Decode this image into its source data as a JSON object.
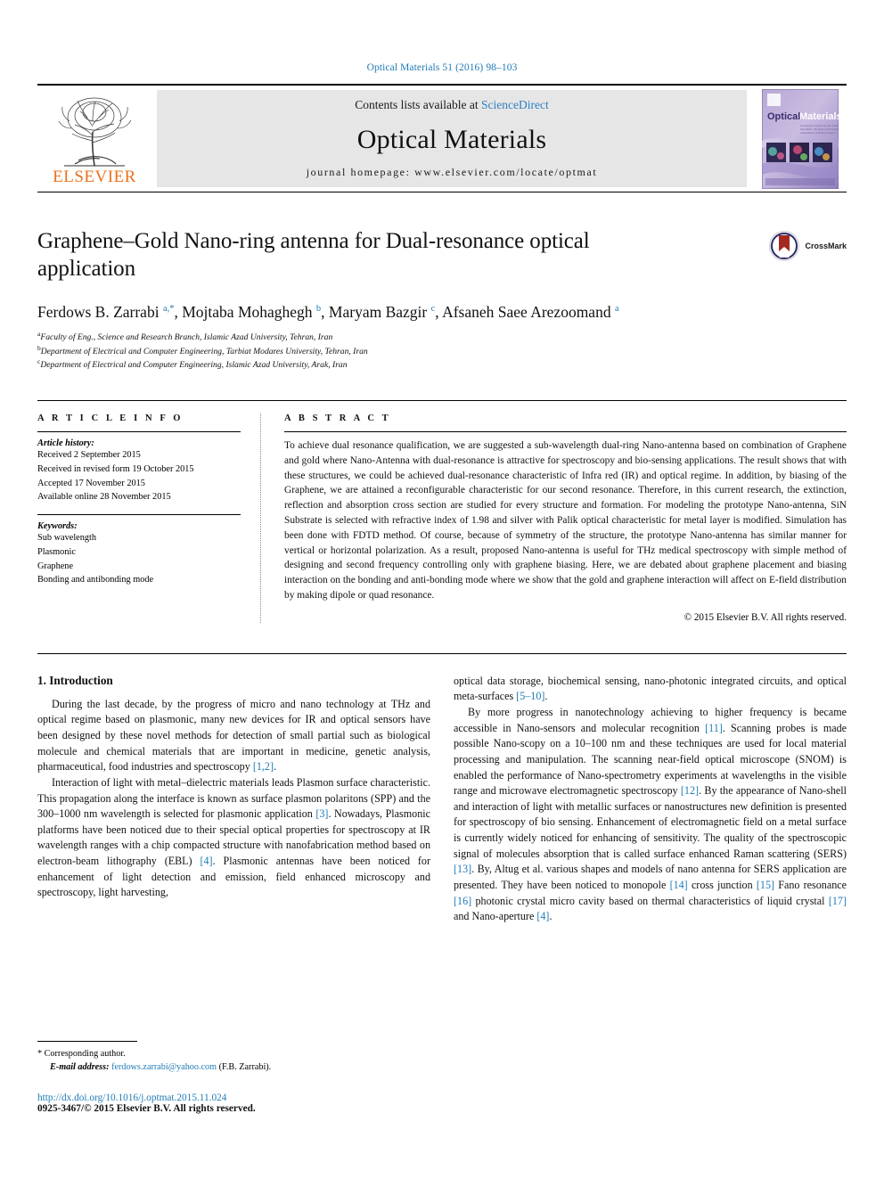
{
  "running_head": "Optical Materials 51 (2016) 98–103",
  "masthead": {
    "publisher": "ELSEVIER",
    "contents_prefix": "Contents lists available at ",
    "contents_link": "ScienceDirect",
    "journal_title": "Optical Materials",
    "homepage": "journal homepage: www.elsevier.com/locate/optmat",
    "cover_title_1": "Optical",
    "cover_title_2": "Materials"
  },
  "article": {
    "title": "Graphene–Gold Nano-ring antenna for Dual-resonance optical application",
    "crossmark_label": "CrossMark",
    "authors_html": "Ferdows B. Zarrabi <sup>a,*</sup>, Mojtaba Mohaghegh <sup>b</sup>, Maryam Bazgir <sup>c</sup>, Afsaneh Saee Arezoomand <sup>a</sup>",
    "affiliations": [
      {
        "marker": "a",
        "text": "Faculty of Eng., Science and Research Branch, Islamic Azad University, Tehran, Iran"
      },
      {
        "marker": "b",
        "text": "Department of Electrical and Computer Engineering, Tarbiat Modares University, Tehran, Iran"
      },
      {
        "marker": "c",
        "text": "Department of Electrical and Computer Engineering, Islamic Azad University, Arak, Iran"
      }
    ]
  },
  "article_info": {
    "heading": "A R T I C L E   I N F O",
    "history_label": "Article history:",
    "history": [
      "Received 2 September 2015",
      "Received in revised form 19 October 2015",
      "Accepted 17 November 2015",
      "Available online 28 November 2015"
    ],
    "keywords_label": "Keywords:",
    "keywords": [
      "Sub wavelength",
      "Plasmonic",
      "Graphene",
      "Bonding and antibonding mode"
    ]
  },
  "abstract": {
    "heading": "A B S T R A C T",
    "text": "To achieve dual resonance qualification, we are suggested a sub-wavelength dual-ring Nano-antenna based on combination of Graphene and gold where Nano-Antenna with dual-resonance is attractive for spectroscopy and bio-sensing applications. The result shows that with these structures, we could be achieved dual-resonance characteristic of Infra red (IR) and optical regime. In addition, by biasing of the Graphene, we are attained a reconfigurable characteristic for our second resonance. Therefore, in this current research, the extinction, reflection and absorption cross section are studied for every structure and formation. For modeling the prototype Nano-antenna, SiN Substrate is selected with refractive index of 1.98 and silver with Palik optical characteristic for metal layer is modified. Simulation has been done with FDTD method. Of course, because of symmetry of the structure, the prototype Nano-antenna has similar manner for vertical or horizontal polarization. As a result, proposed Nano-antenna is useful for THz medical spectroscopy with simple method of designing and second frequency controlling only with graphene biasing. Here, we are debated about graphene placement and biasing interaction on the bonding and anti-bonding mode where we show that the gold and graphene interaction will affect on E-field distribution by making dipole or quad resonance.",
    "copyright": "© 2015 Elsevier B.V. All rights reserved."
  },
  "body": {
    "section_heading": "1. Introduction",
    "left_paragraphs_html": [
      "During the last decade, by the progress of micro and nano technology at THz and optical regime based on plasmonic, many new devices for IR and optical sensors have been designed by these novel methods for detection of small partial such as biological molecule and chemical materials that are important in medicine, genetic analysis, pharmaceutical, food industries and spectroscopy <span class=\"ref\">[1,2]</span>.",
      "Interaction of light with metal–dielectric materials leads Plasmon surface characteristic. This propagation along the interface is known as surface plasmon polaritons (SPP) and the 300–1000 nm wavelength is selected for plasmonic application <span class=\"ref\">[3]</span>. Nowadays, Plasmonic platforms have been noticed due to their special optical properties for spectroscopy at IR wavelength ranges with a chip compacted structure with nanofabrication method based on electron-beam lithography (EBL) <span class=\"ref\">[4]</span>. Plasmonic antennas have been noticed for enhancement of light detection and emission, field enhanced microscopy and spectroscopy, light harvesting,"
    ],
    "right_paragraphs_html": [
      "optical data storage, biochemical sensing, nano-photonic integrated circuits, and optical meta-surfaces <span class=\"ref\">[5–10]</span>.",
      "By more progress in nanotechnology achieving to higher frequency is became accessible in Nano-sensors and molecular recognition <span class=\"ref\">[11]</span>. Scanning probes is made possible Nano-scopy on a 10–100 nm and these techniques are used for local material processing and manipulation. The scanning near-field optical microscope (SNOM) is enabled the performance of Nano-spectrometry experiments at wavelengths in the visible range and microwave electromagnetic spectroscopy <span class=\"ref\">[12]</span>. By the appearance of Nano-shell and interaction of light with metallic surfaces or nanostructures new definition is presented for spectroscopy of bio sensing. Enhancement of electromagnetic field on a metal surface is currently widely noticed for enhancing of sensitivity. The quality of the spectroscopic signal of molecules absorption that is called surface enhanced Raman scattering (SERS) <span class=\"ref\">[13]</span>. By, Altug et al. various shapes and models of nano antenna for SERS application are presented. They have been noticed to monopole <span class=\"ref\">[14]</span> cross junction <span class=\"ref\">[15]</span> Fano resonance <span class=\"ref\">[16]</span> photonic crystal micro cavity based on thermal characteristics of liquid crystal <span class=\"ref\">[17]</span> and Nano-aperture <span class=\"ref\">[4]</span>."
    ]
  },
  "footer": {
    "corresponding_marker": "*",
    "corresponding_text": "Corresponding author.",
    "email_label": "E-mail address:",
    "email": "ferdows.zarrabi@yahoo.com",
    "email_suffix": "(F.B. Zarrabi).",
    "doi": "http://dx.doi.org/10.1016/j.optmat.2015.11.024",
    "issn_line": "0925-3467/© 2015 Elsevier B.V. All rights reserved."
  },
  "colors": {
    "link": "#1f7bb6",
    "elsevier_orange": "#E9711C",
    "band_gray": "#e6e6e6"
  }
}
